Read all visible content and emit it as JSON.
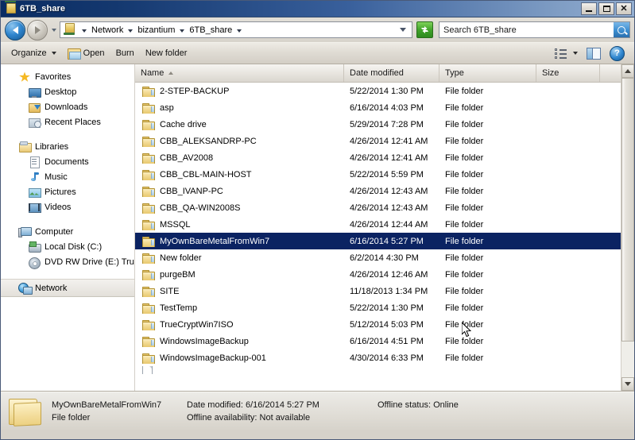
{
  "window": {
    "title": "6TB_share",
    "minimize_label": "Minimize",
    "maximize_label": "Maximize",
    "close_label": "Close"
  },
  "address_bar": {
    "back_label": "Back",
    "forward_label": "Forward",
    "history_label": "Recent pages",
    "crumbs": [
      "Network",
      "bizantium",
      "6TB_share"
    ],
    "dropdown_label": "Previous locations",
    "refresh_label": "Refresh"
  },
  "search": {
    "value": "Search 6TB_share",
    "button_label": "Search"
  },
  "toolbar": {
    "organize_label": "Organize",
    "open_label": "Open",
    "burn_label": "Burn",
    "new_folder_label": "New folder",
    "view_label": "Change your view",
    "preview_label": "Show the preview pane",
    "help_label": "Get help"
  },
  "sidebar": {
    "groups": [
      {
        "header": "Favorites",
        "icon": "star-icon",
        "items": [
          {
            "label": "Desktop",
            "icon": "desktop-icon"
          },
          {
            "label": "Downloads",
            "icon": "downloads-icon"
          },
          {
            "label": "Recent Places",
            "icon": "recent-places-icon"
          }
        ]
      },
      {
        "header": "Libraries",
        "icon": "libraries-icon",
        "items": [
          {
            "label": "Documents",
            "icon": "documents-icon"
          },
          {
            "label": "Music",
            "icon": "music-icon"
          },
          {
            "label": "Pictures",
            "icon": "pictures-icon"
          },
          {
            "label": "Videos",
            "icon": "videos-icon"
          }
        ]
      },
      {
        "header": "Computer",
        "icon": "computer-icon",
        "items": [
          {
            "label": "Local Disk (C:)",
            "icon": "local-disk-icon"
          },
          {
            "label": "DVD RW Drive (E:) Tru",
            "icon": "dvd-drive-icon"
          }
        ]
      },
      {
        "header": "Network",
        "icon": "network-icon",
        "items": [],
        "selected": true
      }
    ]
  },
  "file_list": {
    "columns": [
      {
        "label": "Name",
        "sorted": "asc"
      },
      {
        "label": "Date modified"
      },
      {
        "label": "Type"
      },
      {
        "label": "Size"
      }
    ],
    "rows": [
      {
        "name": "2-STEP-BACKUP",
        "date": "5/22/2014 1:30 PM",
        "type": "File folder",
        "size": "",
        "icon": "folder-icon"
      },
      {
        "name": "asp",
        "date": "6/16/2014 4:03 PM",
        "type": "File folder",
        "size": "",
        "icon": "folder-icon"
      },
      {
        "name": "Cache drive",
        "date": "5/29/2014 7:28 PM",
        "type": "File folder",
        "size": "",
        "icon": "folder-icon"
      },
      {
        "name": "CBB_ALEKSANDRP-PC",
        "date": "4/26/2014 12:41 AM",
        "type": "File folder",
        "size": "",
        "icon": "folder-icon"
      },
      {
        "name": "CBB_AV2008",
        "date": "4/26/2014 12:41 AM",
        "type": "File folder",
        "size": "",
        "icon": "folder-icon"
      },
      {
        "name": "CBB_CBL-MAIN-HOST",
        "date": "5/22/2014 5:59 PM",
        "type": "File folder",
        "size": "",
        "icon": "folder-icon"
      },
      {
        "name": "CBB_IVANP-PC",
        "date": "4/26/2014 12:43 AM",
        "type": "File folder",
        "size": "",
        "icon": "folder-icon"
      },
      {
        "name": "CBB_QA-WIN2008S",
        "date": "4/26/2014 12:43 AM",
        "type": "File folder",
        "size": "",
        "icon": "folder-icon"
      },
      {
        "name": "MSSQL",
        "date": "4/26/2014 12:44 AM",
        "type": "File folder",
        "size": "",
        "icon": "folder-icon"
      },
      {
        "name": "MyOwnBareMetalFromWin7",
        "date": "6/16/2014 5:27 PM",
        "type": "File folder",
        "size": "",
        "icon": "folder-icon",
        "selected": true
      },
      {
        "name": "New folder",
        "date": "6/2/2014 4:30 PM",
        "type": "File folder",
        "size": "",
        "icon": "folder-icon"
      },
      {
        "name": "purgeBM",
        "date": "4/26/2014 12:46 AM",
        "type": "File folder",
        "size": "",
        "icon": "folder-icon"
      },
      {
        "name": "SITE",
        "date": "11/18/2013 1:34 PM",
        "type": "File folder",
        "size": "",
        "icon": "folder-icon"
      },
      {
        "name": "TestTemp",
        "date": "5/22/2014 1:30 PM",
        "type": "File folder",
        "size": "",
        "icon": "folder-icon"
      },
      {
        "name": "TrueCryptWin7ISO",
        "date": "5/12/2014 5:03 PM",
        "type": "File folder",
        "size": "",
        "icon": "folder-icon"
      },
      {
        "name": "WindowsImageBackup",
        "date": "6/16/2014 4:51 PM",
        "type": "File folder",
        "size": "",
        "icon": "folder-icon"
      },
      {
        "name": "WindowsImageBackup-001",
        "date": "4/30/2014 6:33 PM",
        "type": "File folder",
        "size": "",
        "icon": "folder-icon"
      },
      {
        "name": "",
        "date": "",
        "type": "",
        "size": "",
        "icon": "file-icon",
        "partial": true
      }
    ],
    "scrollbar": {
      "up_label": "Scroll up",
      "down_label": "Scroll down"
    }
  },
  "details_pane": {
    "name": "MyOwnBareMetalFromWin7",
    "type": "File folder",
    "date_modified_label": "Date modified:",
    "date_modified_value": "6/16/2014 5:27 PM",
    "offline_availability_label": "Offline availability:",
    "offline_availability_value": "Not available",
    "offline_status_label": "Offline status:",
    "offline_status_value": "Online"
  },
  "colors": {
    "selection_blue": "#0b2362",
    "chrome": "#d6d2ca",
    "title_dark": "#0a2c63",
    "folder_yellow": "#f3dc97"
  }
}
